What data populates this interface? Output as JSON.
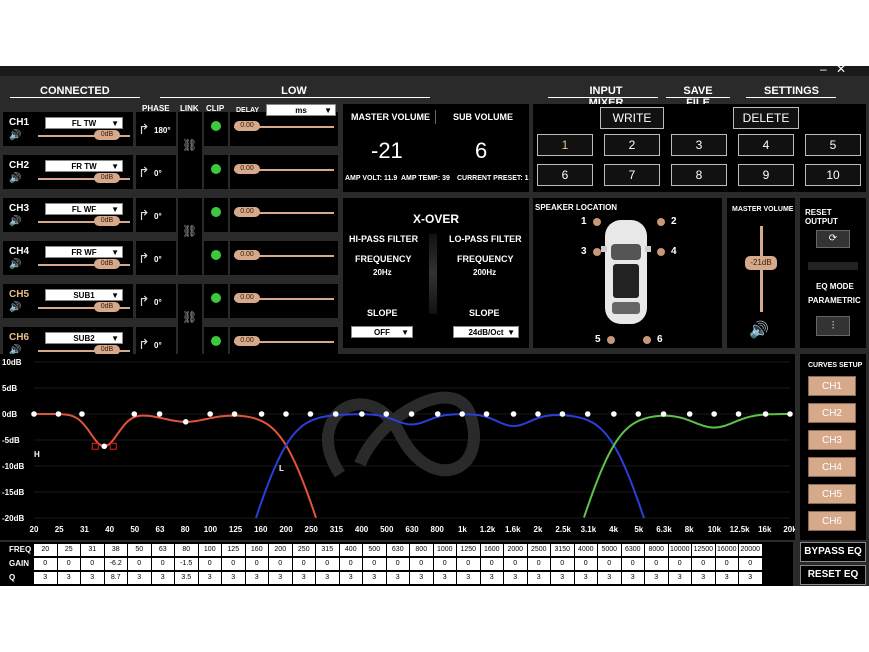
{
  "window": {
    "minimize": "–",
    "close": "✕"
  },
  "topbar": {
    "connected": "CONNECTED",
    "low": "LOW",
    "input_mixer": "INPUT MIXER",
    "save_file": "SAVE FILE",
    "settings": "SETTINGS"
  },
  "channels_header": {
    "phase": "PHASE",
    "link": "LINK",
    "clip": "CLIP",
    "delay": "DELAY",
    "delay_unit": "ms"
  },
  "channels": [
    {
      "name": "CH1",
      "assign": "FL TW",
      "gain": "0dB",
      "phase": "180°",
      "delay": "0.00"
    },
    {
      "name": "CH2",
      "assign": "FR TW",
      "gain": "0dB",
      "phase": "0°",
      "delay": "0.00"
    },
    {
      "name": "CH3",
      "assign": "FL WF",
      "gain": "0dB",
      "phase": "0°",
      "delay": "0.00"
    },
    {
      "name": "CH4",
      "assign": "FR WF",
      "gain": "0dB",
      "phase": "0°",
      "delay": "0.00"
    },
    {
      "name": "CH5",
      "assign": "SUB1",
      "gain": "0dB",
      "phase": "0°",
      "delay": "0.00"
    },
    {
      "name": "CH6",
      "assign": "SUB2",
      "gain": "0dB",
      "phase": "0°",
      "delay": "0.00"
    }
  ],
  "volume": {
    "master_label": "MASTER VOLUME",
    "master_value": "-21",
    "sub_label": "SUB VOLUME",
    "sub_value": "6",
    "amp_volt": "AMP VOLT: 11.9",
    "amp_temp": "AMP TEMP: 39",
    "current_preset": "CURRENT PRESET: 1"
  },
  "xover": {
    "title": "X-OVER",
    "hp_label": "HI-PASS FILTER",
    "lp_label": "LO-PASS FILTER",
    "freq_label": "FREQUENCY",
    "hp_freq": "20Hz",
    "lp_freq": "200Hz",
    "slope_label": "SLOPE",
    "hp_slope": "OFF",
    "lp_slope": "24dB/Oct"
  },
  "presets": {
    "write": "WRITE",
    "delete": "DELETE",
    "numbers": [
      "1",
      "2",
      "3",
      "4",
      "5",
      "6",
      "7",
      "8",
      "9",
      "10"
    ],
    "selected": "1"
  },
  "speaker_location": {
    "title": "SPEAKER LOCATION",
    "positions": [
      "1",
      "2",
      "3",
      "4",
      "5",
      "6"
    ]
  },
  "master_side": {
    "label": "MASTER VOLUME",
    "value": "-21dB"
  },
  "right_panel": {
    "reset_output": "RESET OUTPUT",
    "eq_mode": "EQ MODE",
    "eq_mode_value": "PARAMETRIC"
  },
  "curves": {
    "title": "CURVES SETUP",
    "items": [
      "CH1",
      "CH2",
      "CH3",
      "CH4",
      "CH5",
      "CH6"
    ]
  },
  "graph": {
    "y_ticks": [
      "10dB",
      "5dB",
      "0dB",
      "-5dB",
      "-10dB",
      "-15dB",
      "-20dB"
    ],
    "x_ticks": [
      "20",
      "25",
      "31",
      "40",
      "50",
      "63",
      "80",
      "100",
      "125",
      "160",
      "200",
      "250",
      "315",
      "400",
      "500",
      "630",
      "800",
      "1k",
      "1.2k",
      "1.6k",
      "2k",
      "2.5k",
      "3.1k",
      "4k",
      "5k",
      "6.3k",
      "8k",
      "10k",
      "12.5k",
      "16k",
      "20k"
    ],
    "marker_h": "H",
    "marker_l": "L",
    "colors": {
      "ch1": "#e0553a",
      "ch3": "#2a3fd8",
      "ch5": "#5fc24a"
    }
  },
  "eq_table": {
    "row_labels": [
      "FREQ",
      "GAIN",
      "Q"
    ],
    "freq": [
      "20",
      "25",
      "31",
      "38",
      "50",
      "63",
      "80",
      "100",
      "125",
      "160",
      "200",
      "250",
      "315",
      "400",
      "500",
      "630",
      "800",
      "1000",
      "1250",
      "1600",
      "2000",
      "2500",
      "3150",
      "4000",
      "5000",
      "6300",
      "8000",
      "10000",
      "12500",
      "16000",
      "20000"
    ],
    "gain": [
      "0",
      "0",
      "0",
      "-6.2",
      "0",
      "0",
      "-1.5",
      "0",
      "0",
      "0",
      "0",
      "0",
      "0",
      "0",
      "0",
      "0",
      "0",
      "0",
      "0",
      "0",
      "0",
      "0",
      "0",
      "0",
      "0",
      "0",
      "0",
      "0",
      "0",
      "0",
      "0"
    ],
    "q": [
      "3",
      "3",
      "3",
      "8.7",
      "3",
      "3",
      "3.5",
      "3",
      "3",
      "3",
      "3",
      "3",
      "3",
      "3",
      "3",
      "3",
      "3",
      "3",
      "3",
      "3",
      "3",
      "3",
      "3",
      "3",
      "3",
      "3",
      "3",
      "3",
      "3",
      "3",
      "3"
    ]
  },
  "buttons": {
    "bypass_eq": "BYPASS EQ",
    "reset_eq": "RESET EQ"
  }
}
